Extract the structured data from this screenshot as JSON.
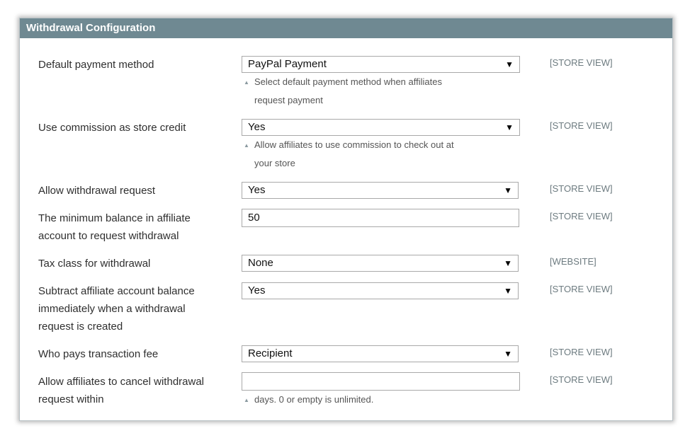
{
  "panel": {
    "title": "Withdrawal Configuration"
  },
  "fields": [
    {
      "label": "Default payment method",
      "type": "select",
      "value": "PayPal Payment",
      "scope": "[STORE VIEW]",
      "note_line1": "Select default payment method when affiliates",
      "note_line2": "request payment"
    },
    {
      "label": "Use commission as store credit",
      "type": "select",
      "value": "Yes",
      "scope": "[STORE VIEW]",
      "note_line1": "Allow affiliates to use commission to check out at",
      "note_line2": "your store"
    },
    {
      "label": "Allow withdrawal request",
      "type": "select",
      "value": "Yes",
      "scope": "[STORE VIEW]"
    },
    {
      "label_line1": "The minimum balance in affiliate",
      "label_line2": "account to request withdrawal",
      "type": "text",
      "value": "50",
      "scope": "[STORE VIEW]"
    },
    {
      "label": "Tax class for withdrawal",
      "type": "select",
      "value": "None",
      "scope": "[WEBSITE]"
    },
    {
      "label_line1": "Subtract affiliate account balance",
      "label_line2": "immediately when a withdrawal",
      "label_line3": "request is created",
      "type": "select",
      "value": "Yes",
      "scope": "[STORE VIEW]"
    },
    {
      "label": "Who pays transaction fee",
      "type": "select",
      "value": "Recipient",
      "scope": "[STORE VIEW]"
    },
    {
      "label_line1": "Allow affiliates to cancel withdrawal",
      "label_line2": "request within",
      "type": "text",
      "value": "",
      "scope": "[STORE VIEW]",
      "note_line1": "days. 0 or empty is unlimited."
    }
  ],
  "icons": {
    "dropdown": "chevron-down-icon",
    "note": "note-triangle-icon"
  },
  "colors": {
    "header_bg": "#6f8992",
    "header_text": "#ffffff",
    "scope_text": "#6d7b80"
  }
}
